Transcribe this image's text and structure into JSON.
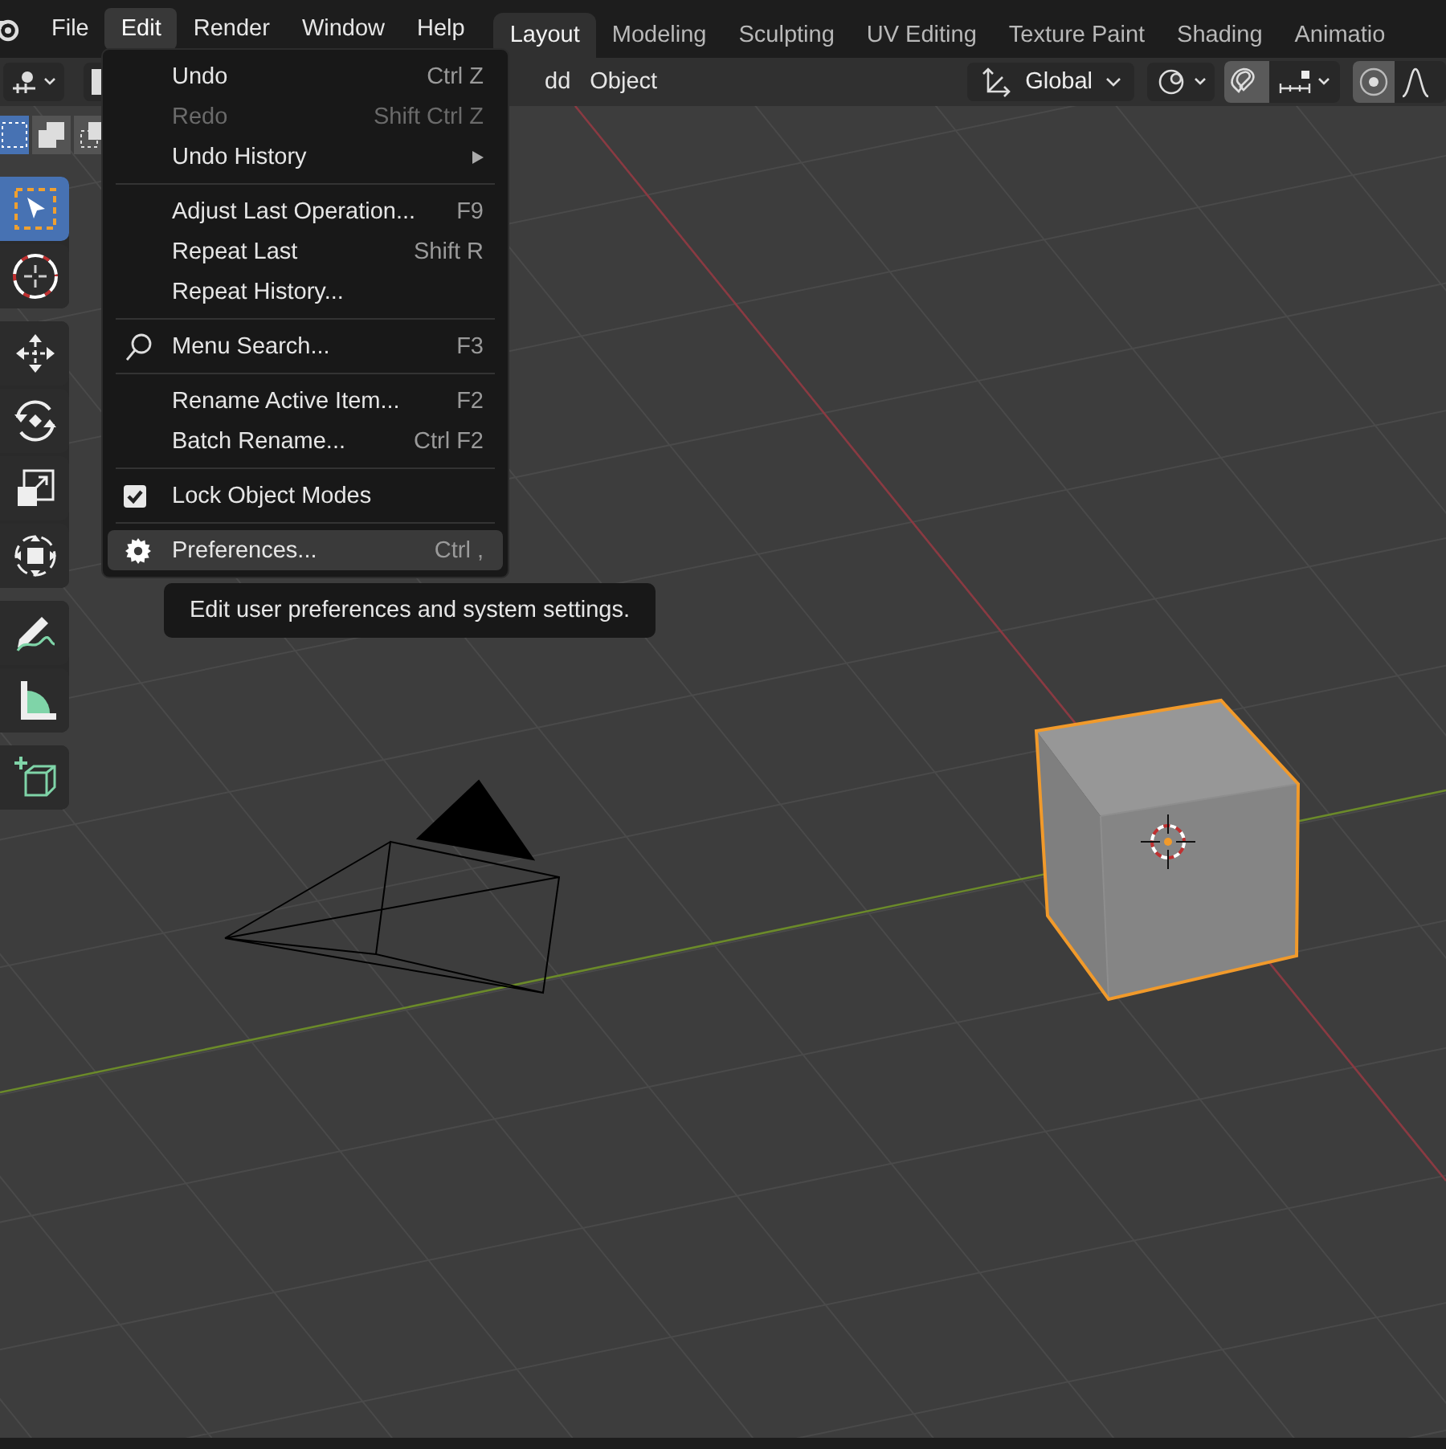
{
  "top_bar": {
    "menus": [
      {
        "label": "File",
        "selected": false
      },
      {
        "label": "Edit",
        "selected": true
      },
      {
        "label": "Render",
        "selected": false
      },
      {
        "label": "Window",
        "selected": false
      },
      {
        "label": "Help",
        "selected": false
      }
    ],
    "workspaces": [
      {
        "label": "Layout",
        "selected": true
      },
      {
        "label": "Modeling",
        "selected": false
      },
      {
        "label": "Sculpting",
        "selected": false
      },
      {
        "label": "UV Editing",
        "selected": false
      },
      {
        "label": "Texture Paint",
        "selected": false
      },
      {
        "label": "Shading",
        "selected": false
      },
      {
        "label": "Animatio",
        "selected": false
      }
    ]
  },
  "header": {
    "menus": [
      "dd",
      "Object"
    ],
    "orientation": "Global"
  },
  "select_modes": [
    {
      "kind": "new",
      "selected": true
    },
    {
      "kind": "extend",
      "selected": false
    },
    {
      "kind": "subtract",
      "selected": false
    }
  ],
  "toolbar": [
    [
      {
        "kind": "select",
        "selected": true
      },
      {
        "kind": "cursor",
        "selected": false
      }
    ],
    [
      {
        "kind": "move",
        "selected": false
      },
      {
        "kind": "rotate",
        "selected": false
      },
      {
        "kind": "scale",
        "selected": false
      },
      {
        "kind": "transform",
        "selected": false
      }
    ],
    [
      {
        "kind": "annotate",
        "selected": false
      },
      {
        "kind": "measure",
        "selected": false
      }
    ],
    [
      {
        "kind": "add-cube",
        "selected": false
      }
    ]
  ],
  "edit_menu": {
    "groups": [
      [
        {
          "kind": "plain",
          "label": "Undo",
          "shortcut": "Ctrl Z",
          "disabled": false,
          "selected": false,
          "submenu": false
        },
        {
          "kind": "plain",
          "label": "Redo",
          "shortcut": "Shift Ctrl Z",
          "disabled": true,
          "selected": false,
          "submenu": false
        },
        {
          "kind": "plain",
          "label": "Undo History",
          "disabled": false,
          "selected": false,
          "submenu": true
        }
      ],
      [
        {
          "kind": "plain",
          "label": "Adjust Last Operation...",
          "shortcut": "F9",
          "disabled": false,
          "selected": false,
          "submenu": false
        },
        {
          "kind": "plain",
          "label": "Repeat Last",
          "shortcut": "Shift R",
          "disabled": false,
          "selected": false,
          "submenu": false
        },
        {
          "kind": "plain",
          "label": "Repeat History...",
          "disabled": false,
          "selected": false,
          "submenu": false
        }
      ],
      [
        {
          "kind": "search",
          "label": "Menu Search...",
          "shortcut": "F3",
          "disabled": false,
          "selected": false,
          "submenu": false
        }
      ],
      [
        {
          "kind": "plain",
          "label": "Rename Active Item...",
          "shortcut": "F2",
          "disabled": false,
          "selected": false,
          "submenu": false
        },
        {
          "kind": "plain",
          "label": "Batch Rename...",
          "shortcut": "Ctrl F2",
          "disabled": false,
          "selected": false,
          "submenu": false
        }
      ],
      [
        {
          "kind": "checkbox",
          "label": "Lock Object Modes",
          "checked": true,
          "disabled": false,
          "selected": false,
          "submenu": false
        }
      ],
      [
        {
          "kind": "gear",
          "label": "Preferences...",
          "shortcut": "Ctrl ,",
          "disabled": false,
          "selected": true,
          "submenu": false
        }
      ]
    ]
  },
  "tooltip": "Edit user preferences and system settings."
}
